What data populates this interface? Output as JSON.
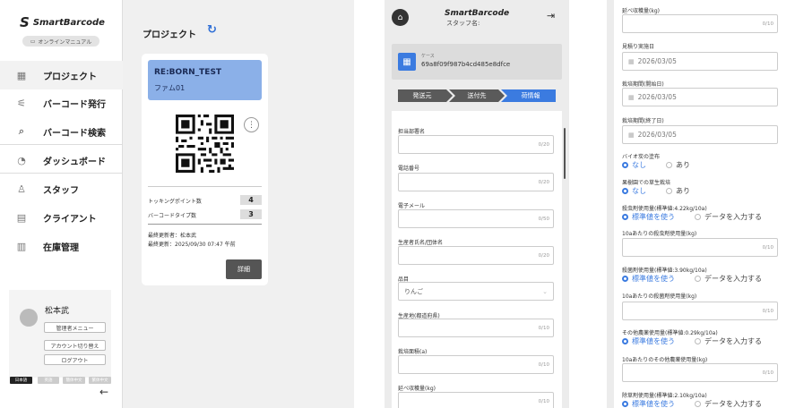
{
  "panel_a": {
    "logo_mark": "S",
    "logo_text": "SmartBarcode",
    "manual_label": "オンラインマニュアル",
    "nav": [
      {
        "icon": "project-icon",
        "label": "プロジェクト"
      },
      {
        "icon": "barcode-issue-icon",
        "label": "バーコード発行"
      },
      {
        "icon": "barcode-search-icon",
        "label": "バーコード検索"
      },
      {
        "icon": "dashboard-icon",
        "label": "ダッシュボード"
      },
      {
        "icon": "staff-icon",
        "label": "スタッフ"
      },
      {
        "icon": "client-icon",
        "label": "クライアント"
      },
      {
        "icon": "inventory-icon",
        "label": "在庫管理"
      }
    ],
    "user_name": "松本武",
    "admin_menu": "管理者メニュー",
    "switch_account": "アカウント切り替え",
    "logout": "ログアウト",
    "languages": [
      "日本語",
      "英語",
      "簡体中文",
      "繁体中文"
    ],
    "back_arrow": "←",
    "page_title": "プロジェクト",
    "refresh_icon": "↻",
    "card": {
      "title": "RE:BORN_TEST",
      "subtitle": "ファム01",
      "kebab": "⋮",
      "stats": [
        {
          "label": "トッキングポイント数",
          "value": "4"
        },
        {
          "label": "バーコードタイプ数",
          "value": "3"
        }
      ],
      "last_updater": "最終更新者：松本武",
      "last_updated": "最終更新：2025/09/30 07:47 午前",
      "detail_button": "詳細"
    }
  },
  "panel_b": {
    "home_icon": "⌂",
    "logo": "SmartBarcode",
    "staff_label": "スタッフ名:",
    "logout_icon": "⇥",
    "case_label": "ケース",
    "case_id": "69a8f09f987b4cd485e8dfce",
    "steps": [
      "発送元",
      "送付先",
      "荷情報"
    ],
    "fields": [
      {
        "label": "担当部署名",
        "counter": "0/20"
      },
      {
        "label": "電話番号",
        "counter": "0/20"
      },
      {
        "label": "電子メール",
        "counter": "0/50"
      },
      {
        "label": "生産者氏名/団体名",
        "counter": "0/20"
      },
      {
        "label": "品目",
        "select": "りんご"
      },
      {
        "label": "生産地(都道府県)",
        "counter": "0/10"
      },
      {
        "label": "栽培面積(a)",
        "counter": "0/10"
      },
      {
        "label": "延べ収穫量(kg)",
        "counter": "0/10"
      }
    ]
  },
  "panel_c": {
    "top_label": "延べ収穫量(kg)",
    "top_counter": "0/10",
    "dates": [
      {
        "label": "見積り実施日",
        "value": "2026/03/05"
      },
      {
        "label": "栽培期間(開始日)",
        "value": "2026/03/05"
      },
      {
        "label": "栽培期間(終了日)",
        "value": "2026/03/05"
      }
    ],
    "radio_groups": [
      {
        "label": "バイオ炭の塗布",
        "options": [
          "なし",
          "あり"
        ]
      },
      {
        "label": "果樹園での草生栽培",
        "options": [
          "なし",
          "あり"
        ]
      },
      {
        "label": "殺虫剤使用量(標準値:4.22kg/10a)",
        "options": [
          "標準値を使う",
          "データを入力する"
        ]
      }
    ],
    "field1": {
      "label": "10aあたりの殺虫剤使用量(kg)",
      "counter": "0/10"
    },
    "radio2": {
      "label": "殺菌剤使用量(標準値:3.90kg/10a)",
      "options": [
        "標準値を使う",
        "データを入力する"
      ]
    },
    "field2": {
      "label": "10aあたりの殺菌剤使用量(kg)",
      "counter": "0/10"
    },
    "radio3": {
      "label": "その他農薬使用量(標準値:0.29kg/10a)",
      "options": [
        "標準値を使う",
        "データを入力する"
      ]
    },
    "field3": {
      "label": "10aあたりのその他農薬使用量(kg)",
      "counter": "0/10"
    },
    "radio4": {
      "label": "除草剤使用量(標準値:2.10kg/10a)",
      "options": [
        "標準値を使う",
        "データを入力する"
      ]
    }
  },
  "colors": {
    "accent": "#3b7be0",
    "card_header": "#8bb0e8",
    "step_inactive": "#5a5a5a"
  }
}
